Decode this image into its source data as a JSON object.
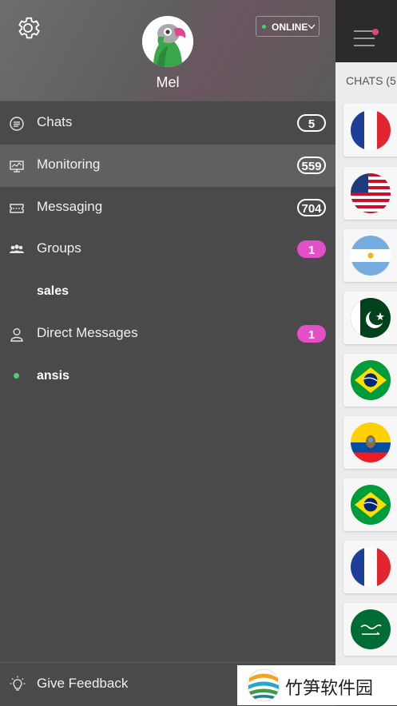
{
  "profile": {
    "username": "Mel",
    "status": "ONLINE"
  },
  "menu": {
    "items": [
      {
        "label": "Chats",
        "badge": "5"
      },
      {
        "label": "Monitoring",
        "badge": "559"
      },
      {
        "label": "Messaging",
        "badge": "704"
      },
      {
        "label": "Groups",
        "badge": "1"
      },
      {
        "label": "Direct Messages",
        "badge": "1"
      }
    ],
    "groups": [
      "sales"
    ],
    "direct_messages": [
      "ansis"
    ]
  },
  "footer": {
    "feedback_label": "Give Feedback"
  },
  "right_panel": {
    "tab_label": "CHATS (5",
    "flags": [
      "france-flag",
      "usa-flag",
      "argentina-flag",
      "pakistan-flag",
      "brazil-flag",
      "ecuador-flag",
      "brazil-flag",
      "france-flag",
      "saudi-arabia-flag"
    ]
  },
  "watermark": {
    "text": "竹笋软件园"
  },
  "colors": {
    "accent_pink": "#e24fc6",
    "online_green": "#4bd26e",
    "drawer_bg": "#4a4a4a"
  }
}
